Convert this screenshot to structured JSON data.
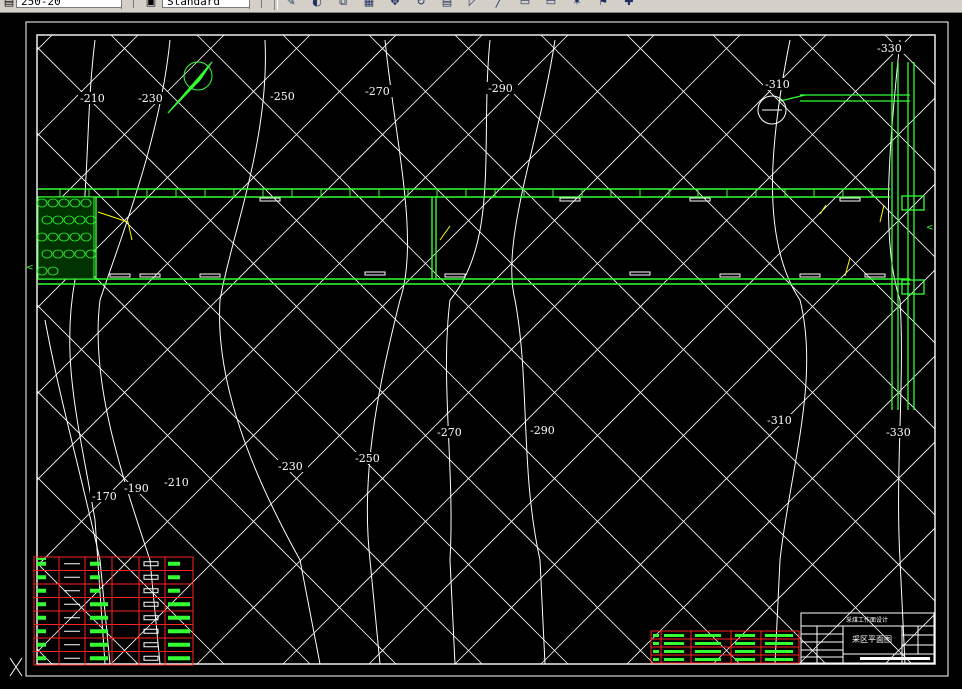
{
  "toolbar": {
    "layer_combo_value": "250-20",
    "style_combo_value": "Standard",
    "icons": [
      "pencil-icon",
      "eraser-icon",
      "copy-icon",
      "grid-icon",
      "move-icon",
      "rotate-icon",
      "table-icon",
      "ruler-icon",
      "line-icon",
      "box-icon",
      "box2-icon",
      "star-icon",
      "flag-icon",
      "tool-icon"
    ]
  },
  "drawing": {
    "contour_labels": [
      {
        "text": "-210",
        "pos": "top-left"
      },
      {
        "text": "-230",
        "pos": "top"
      },
      {
        "text": "-250",
        "pos": "top"
      },
      {
        "text": "-270",
        "pos": "top"
      },
      {
        "text": "-290",
        "pos": "top"
      },
      {
        "text": "-310",
        "pos": "top-right"
      },
      {
        "text": "-330",
        "pos": "top-right"
      },
      {
        "text": "-170",
        "pos": "bottom-left"
      },
      {
        "text": "-190",
        "pos": "bottom-left"
      },
      {
        "text": "-210",
        "pos": "bottom-left"
      },
      {
        "text": "-230",
        "pos": "bottom"
      },
      {
        "text": "-250",
        "pos": "bottom"
      },
      {
        "text": "-270",
        "pos": "bottom"
      },
      {
        "text": "-290",
        "pos": "bottom"
      },
      {
        "text": "-310",
        "pos": "bottom-right"
      },
      {
        "text": "-330",
        "pos": "bottom-right"
      }
    ],
    "title_block": {
      "header": "采煤工作面设计",
      "title": "采区平面图"
    },
    "colors": {
      "background": "#000000",
      "contour": "#ffffff",
      "roadway": "#33ff33",
      "frame": "#ffffff",
      "legend_grid": "#ff2222",
      "annotation": "#ffff00"
    }
  }
}
